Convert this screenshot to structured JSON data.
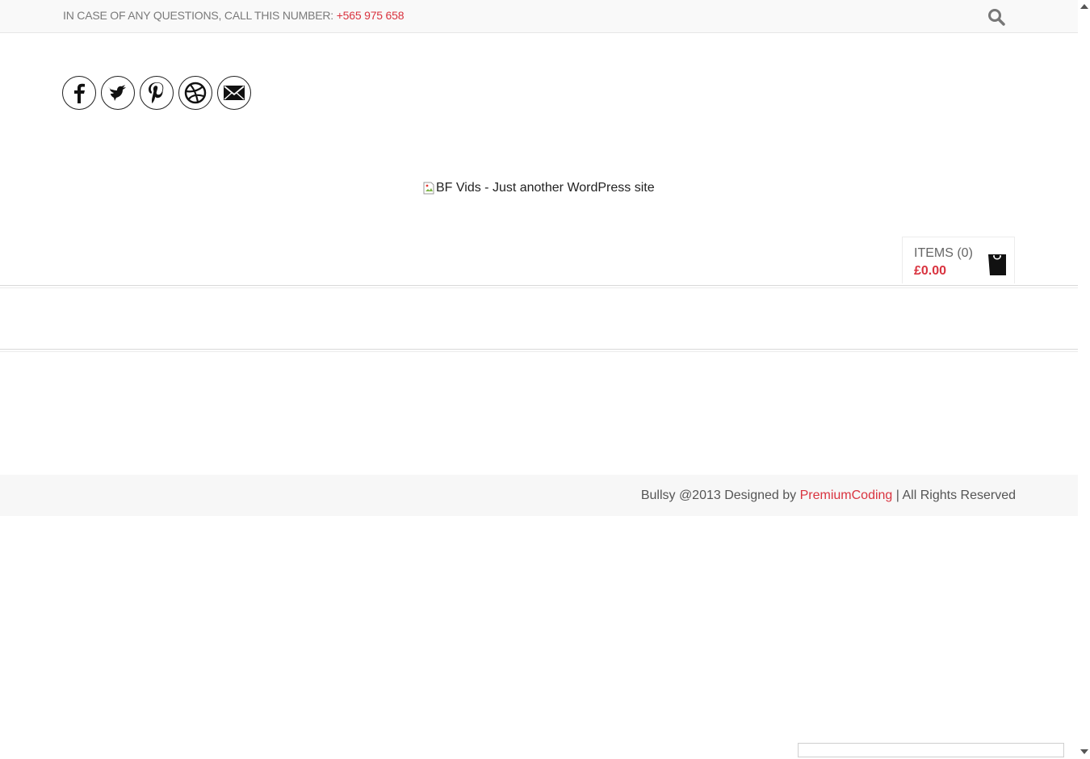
{
  "topbar": {
    "contact_text": "IN CASE OF ANY QUESTIONS, CALL THIS NUMBER: ",
    "phone": "+565 975 658",
    "search_icon": "search-icon"
  },
  "social": [
    "facebook-icon",
    "twitter-icon",
    "pinterest-icon",
    "dribbble-icon",
    "mail-icon"
  ],
  "logo": {
    "alt": "BF Vids - Just another WordPress site"
  },
  "cart": {
    "items_label": "ITEMS (0)",
    "total": "£0.00",
    "icon": "shopping-bag-icon"
  },
  "footer": {
    "prefix": "Bullsy @2013 Designed by ",
    "link": "PremiumCoding",
    "suffix": " | All Rights Reserved"
  },
  "colors": {
    "accent": "#d9333f",
    "topbar_bg": "#f9f9f9",
    "footer_bg": "#f7f7f7"
  }
}
